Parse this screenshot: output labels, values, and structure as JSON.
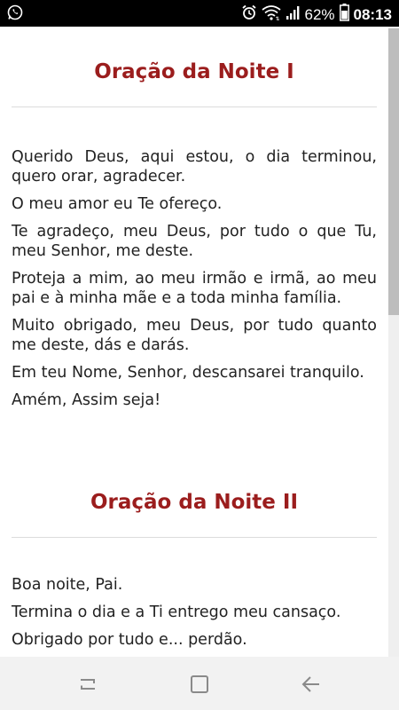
{
  "status_bar": {
    "left_icons": [
      "whatsapp-icon"
    ],
    "right_icons": [
      "alarm-icon",
      "wifi-icon",
      "signal-icon"
    ],
    "battery_percent": "62%",
    "time": "08:13"
  },
  "sections": [
    {
      "title": "Oração da Noite I",
      "paragraphs": [
        "Querido Deus, aqui estou, o dia terminou, quero orar, agradecer.",
        "O meu amor eu Te ofereço.",
        "Te agradeço, meu Deus, por tudo o que Tu, meu Senhor, me deste.",
        "Proteja a mim, ao meu irmão e irmã, ao meu pai e à minha mãe e a toda minha família.",
        "Muito obrigado, meu Deus, por tudo quanto me deste, dás e darás.",
        "Em teu Nome, Senhor, descansarei tranquilo.",
        "Amém, Assim seja!"
      ]
    },
    {
      "title": "Oração da Noite II",
      "paragraphs": [
        "Boa noite, Pai.",
        "Termina o dia e a Ti entrego meu cansaço.",
        "Obrigado por tudo e... perdão."
      ]
    }
  ],
  "nav_bar": {
    "icons": [
      "recent-apps-icon",
      "home-icon",
      "back-icon"
    ]
  },
  "colors": {
    "title": "#9b1d1d",
    "text": "#222222",
    "status_bar": "#000000",
    "nav_bar": "#f2f2f2"
  }
}
